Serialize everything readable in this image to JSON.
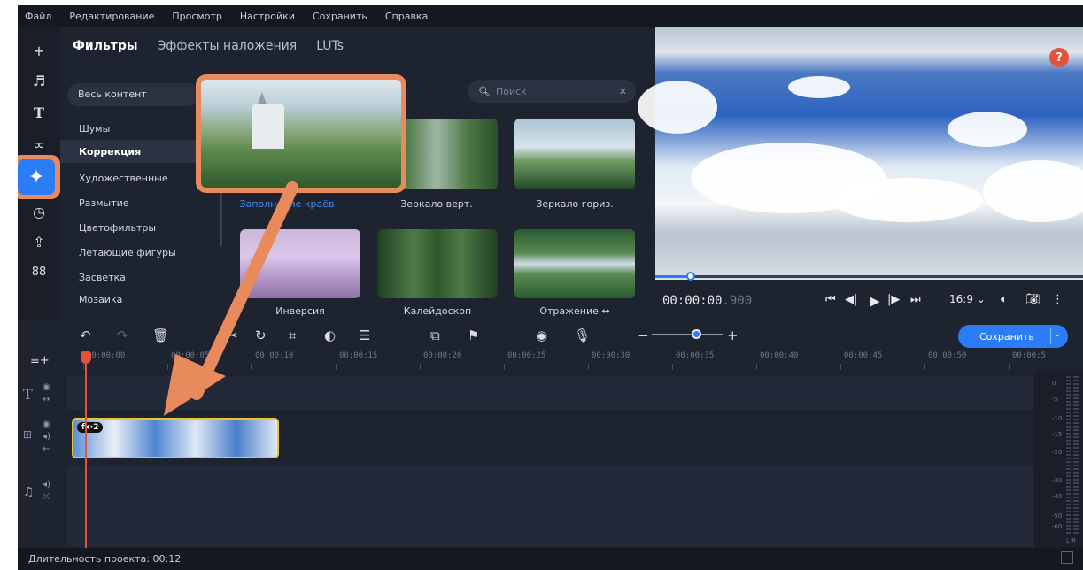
{
  "menu": [
    "Файл",
    "Редактирование",
    "Просмотр",
    "Настройки",
    "Сохранить",
    "Справка"
  ],
  "tabs": {
    "filters": "Фильтры",
    "overlays": "Эффекты наложения",
    "luts": "LUTs"
  },
  "all_content": "Весь контент",
  "search_placeholder": "Поиск",
  "categories": [
    "Шумы",
    "Коррекция",
    "Художественные",
    "Размытие",
    "Цветофильтры",
    "Летающие фигуры",
    "Засветка",
    "Мозаика"
  ],
  "selected_category": "Коррекция",
  "filters": [
    {
      "label": "Заполнение краёв",
      "selected": true
    },
    {
      "label": "Зеркало верт."
    },
    {
      "label": "Зеркало гориз."
    },
    {
      "label": "Инверсия"
    },
    {
      "label": "Калейдоскоп"
    },
    {
      "label": "Отражение ↔"
    }
  ],
  "player": {
    "timecode_main": "00:00:00",
    "timecode_frac": ".900",
    "aspect": "16:9"
  },
  "save_button": "Сохранить",
  "ruler": [
    "00:00:00",
    "00:00:05",
    "00:00:10",
    "00:00:15",
    "00:00:20",
    "00:00:25",
    "00:00:30",
    "00:00:35",
    "00:00:40",
    "00:00:45",
    "00:00:50",
    "00:00:5"
  ],
  "clip_badge": "fx·2",
  "meter_labels": [
    "0",
    "-5",
    "-10",
    "-15",
    "-20",
    "-30",
    "-40",
    "-50",
    "-60"
  ],
  "meter_lr": "L R",
  "status": "Длительность проекта: 00:12",
  "colors": {
    "accent": "#2a7cf7",
    "highlight": "#e98a5c",
    "clip_border": "#e9c531",
    "playhead": "#e2533a"
  }
}
